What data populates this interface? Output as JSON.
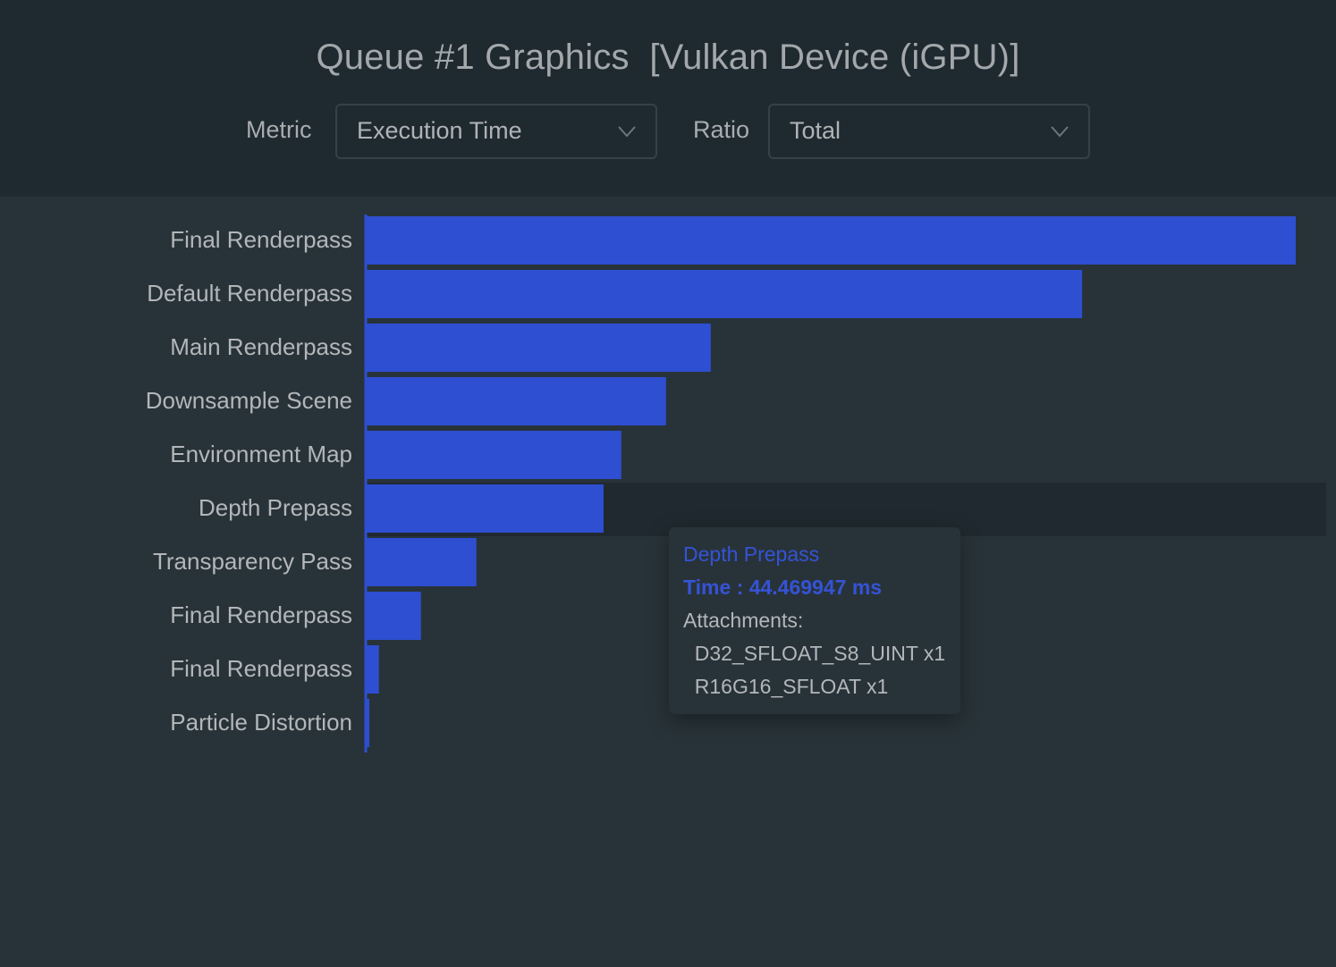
{
  "header": {
    "title": "Queue #1 Graphics  [Vulkan Device (iGPU)]",
    "metric_label": "Metric",
    "metric_value": "Execution Time",
    "ratio_label": "Ratio",
    "ratio_value": "Total",
    "chevron_icon": "chevron-down-icon"
  },
  "colors": {
    "bar": "#2e4fd1",
    "header_bg": "#1f2930",
    "body_bg": "#283339",
    "hover_band": "#1f292f",
    "tooltip_accent": "#3553d6"
  },
  "chart_data": {
    "type": "bar",
    "orientation": "horizontal",
    "title": "Queue #1 Graphics  [Vulkan Device (iGPU)]",
    "xlabel": "Execution Time",
    "ylabel": "",
    "unit": "ms",
    "categories": [
      "Final Renderpass",
      "Default Renderpass",
      "Main Renderpass",
      "Downsample Scene",
      "Environment Map",
      "Depth Prepass",
      "Transparency Pass",
      "Final Renderpass",
      "Final Renderpass",
      "Particle Distortion"
    ],
    "values": [
      174.4,
      134.3,
      64.6,
      56.2,
      47.8,
      44.469947,
      20.6,
      10.2,
      2.3,
      0.5
    ],
    "xlim": [
      0,
      174.4
    ],
    "grid": false,
    "highlighted_index": 5
  },
  "tooltip": {
    "title": "Depth Prepass",
    "time": "Time : 44.469947 ms",
    "attachments_label": "Attachments:",
    "attachments": [
      "  D32_SFLOAT_S8_UINT x1",
      "  R16G16_SFLOAT x1"
    ]
  }
}
